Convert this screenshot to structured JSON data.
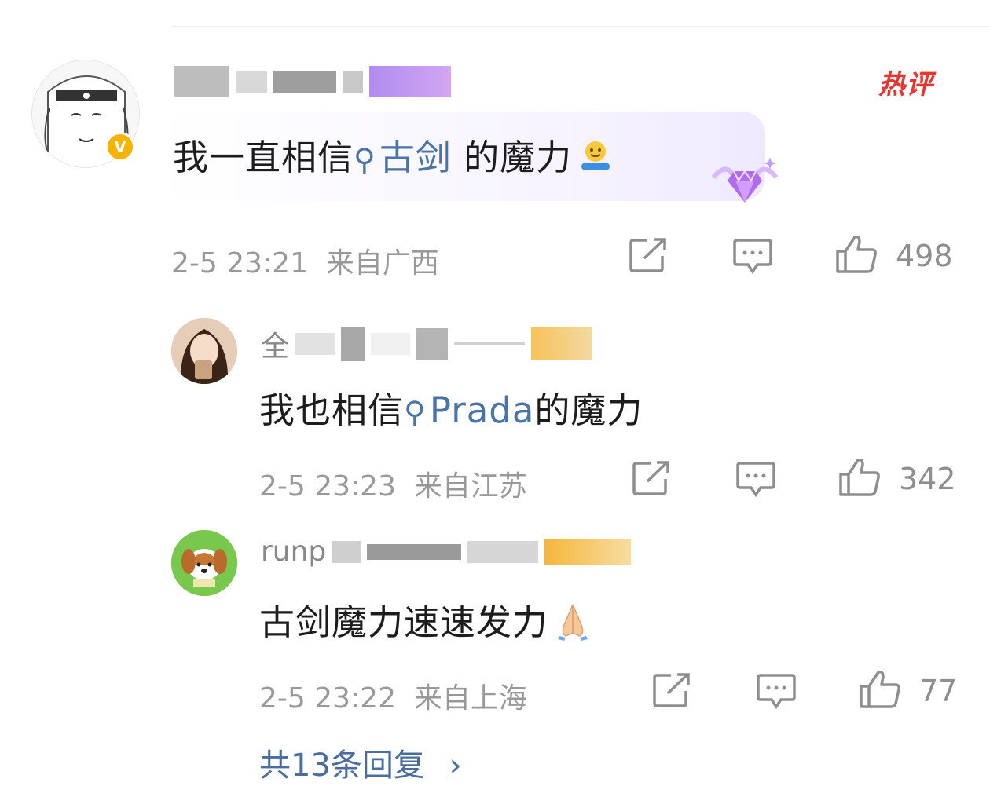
{
  "main_comment": {
    "hot_label": "热评",
    "text_before": "我一直相信",
    "topic": "古剑",
    "text_after": " 的魔力",
    "time": "2-5 23:21",
    "location": "来自广西",
    "likes": "498"
  },
  "replies": [
    {
      "name_visible": "全",
      "text_before": "我也相信",
      "topic": "Prada",
      "text_after": "的魔力",
      "time": "2-5 23:23",
      "location": "来自江苏",
      "likes": "342"
    },
    {
      "name_visible": "runp",
      "text": "古剑魔力速速发力",
      "time": "2-5 23:22",
      "location": "来自上海",
      "likes": "77"
    }
  ],
  "more_replies": {
    "label": "共13条回复",
    "chevron": "›"
  },
  "icons": [
    "verified-badge-icon",
    "share-icon",
    "comment-icon",
    "like-icon",
    "search-icon",
    "diamond-badge-icon",
    "hug-emoji-icon",
    "pray-emoji-icon"
  ],
  "colors": {
    "topic": "#4a73a8",
    "hot": "#e8352f",
    "badge": "#f6b400",
    "meta": "#999999"
  }
}
